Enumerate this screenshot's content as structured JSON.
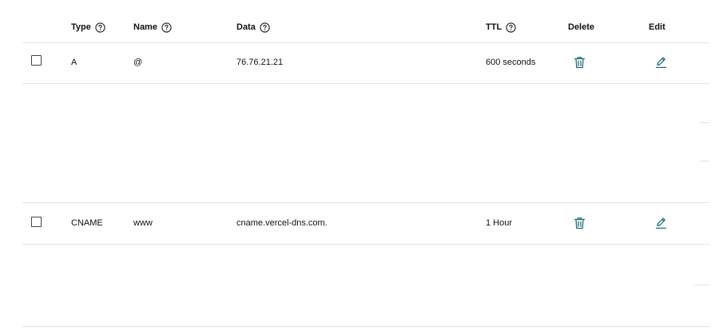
{
  "table": {
    "columns": {
      "type": "Type",
      "name": "Name",
      "data": "Data",
      "ttl": "TTL",
      "delete": "Delete",
      "edit": "Edit"
    },
    "records": [
      {
        "type": "A",
        "name": "@",
        "data": "76.76.21.21",
        "ttl": "600 seconds"
      },
      {
        "type": "CNAME",
        "name": "www",
        "data": "cname.vercel-dns.com.",
        "ttl": "1 Hour"
      }
    ]
  },
  "icons": {
    "help": "question-circle-icon",
    "delete": "trash-icon",
    "edit": "pencil-icon"
  },
  "colors": {
    "action": "#1f6f7a",
    "divider": "#e2e2e2",
    "text": "#111111"
  }
}
